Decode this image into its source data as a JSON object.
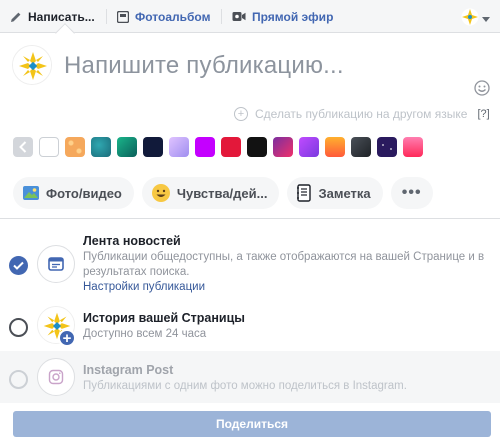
{
  "tabs": {
    "write": {
      "label": "Написать...",
      "icon": "pencil-icon"
    },
    "photo": {
      "label": "Фотоальбом",
      "icon": "photo-album-icon"
    },
    "live": {
      "label": "Прямой эфир",
      "icon": "video-camera-icon"
    }
  },
  "composer": {
    "placeholder": "Напишите публикацию...",
    "translate_label": "Сделать публикацию на другом языке",
    "translate_help": "[?]"
  },
  "swatch_colors": [
    "#f2f3f5",
    "#f5a85c",
    "#1b6c7a",
    "#0c8a6a",
    "#111a3a",
    "#c6a6f6",
    "#c400ff",
    "#e3183a",
    "#121212",
    "#d42e66",
    "#9b4bd8",
    "#ff7a28",
    "#2e3338",
    "#2a1a5e",
    "#ff4d7a"
  ],
  "actions": {
    "photo_video": "Фото/видео",
    "feelings": "Чувства/дей...",
    "note": "Заметка",
    "more": "•••"
  },
  "destinations": {
    "news_feed": {
      "title": "Лента новостей",
      "description": "Публикации общедоступны, а также отображаются на вашей Странице и в результатах поиска.",
      "link": "Настройки публикации",
      "checked": true
    },
    "story": {
      "title": "История вашей Страницы",
      "description": "Доступно всем 24 часа",
      "checked": false
    },
    "instagram": {
      "title": "Instagram Post",
      "description": "Публикациями с одним фото можно поделиться в Instagram.",
      "checked": false,
      "disabled": true
    }
  },
  "share_label": "Поделиться",
  "colors": {
    "accent": "#4267b2",
    "share_disabled": "#9cb4d8"
  }
}
